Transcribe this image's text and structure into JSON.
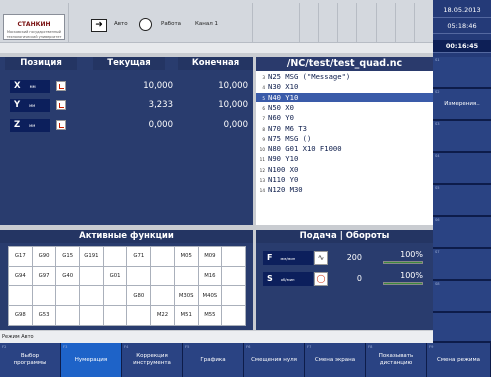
{
  "header": {
    "logo": {
      "title": "СТАНКИН",
      "subtitle": "Московский государственный технологический университет"
    },
    "mode_label": "Авто",
    "status_label": "Работа",
    "channel_label": "Канал 1",
    "date": "18.05.2013",
    "time": "05:18:46",
    "runtime": "00:16:45"
  },
  "position": {
    "col_axis": "Позиция",
    "col_current": "Текущая",
    "col_target": "Конечная",
    "axes": [
      {
        "name": "X",
        "unit": "мм",
        "current": "10,000",
        "target": "10,000"
      },
      {
        "name": "Y",
        "unit": "мм",
        "current": "3,233",
        "target": "10,000"
      },
      {
        "name": "Z",
        "unit": "мм",
        "current": "0,000",
        "target": "0,000"
      }
    ]
  },
  "program": {
    "title": "/NC/test/test_quad.nc",
    "lines": [
      {
        "n": "3",
        "text": "N25 MSG (\"Message\")",
        "active": false
      },
      {
        "n": "4",
        "text": "N30 X10",
        "active": false
      },
      {
        "n": "5",
        "text": "N40 Y10",
        "active": true
      },
      {
        "n": "6",
        "text": "N50 X0",
        "active": false
      },
      {
        "n": "7",
        "text": "N60 Y0",
        "active": false
      },
      {
        "n": "8",
        "text": "N70 M6 T3",
        "active": false
      },
      {
        "n": "9",
        "text": "N75 MSG ()",
        "active": false
      },
      {
        "n": "10",
        "text": "N80 G01 X10 F1000",
        "active": false
      },
      {
        "n": "11",
        "text": "N90 Y10",
        "active": false
      },
      {
        "n": "12",
        "text": "N100 X0",
        "active": false
      },
      {
        "n": "13",
        "text": "N110 Y0",
        "active": false
      },
      {
        "n": "14",
        "text": "N120 M30",
        "active": false
      }
    ]
  },
  "active_functions": {
    "title": "Активные функции",
    "rows": [
      [
        "G17",
        "G90",
        "G15",
        "G191",
        "",
        "G71",
        "",
        "M05",
        "M09",
        ""
      ],
      [
        "G94",
        "G97",
        "G40",
        "",
        "G01",
        "",
        "",
        "",
        "M16",
        ""
      ],
      [
        "",
        "",
        "",
        "",
        "",
        "G80",
        "",
        "M30S",
        "M40S",
        ""
      ],
      [
        "G98",
        "G53",
        "",
        "",
        "",
        "",
        "M22",
        "M51",
        "M55",
        ""
      ]
    ]
  },
  "feed": {
    "title": "Подача | Обороты",
    "feed_label": "F",
    "feed_unit": "мм/мин",
    "feed_value": "200",
    "feed_override": "100%",
    "feed_override_fraction": 1.0,
    "speed_label": "S",
    "speed_unit": "об/мин",
    "speed_value": "0",
    "speed_override": "100%",
    "speed_override_fraction": 1.0
  },
  "status_line": "Режим Авто",
  "right_softkeys": [
    {
      "num": "S1",
      "label": ""
    },
    {
      "num": "S2",
      "label": "Измерения.."
    },
    {
      "num": "S3",
      "label": ""
    },
    {
      "num": "S4",
      "label": ""
    },
    {
      "num": "S5",
      "label": ""
    },
    {
      "num": "S6",
      "label": ""
    },
    {
      "num": "S7",
      "label": ""
    },
    {
      "num": "S8",
      "label": ""
    }
  ],
  "bottom_softkeys": [
    {
      "num": "F2",
      "label": "Выбор программы",
      "selected": false
    },
    {
      "num": "F3",
      "label": "Нумерация",
      "selected": true
    },
    {
      "num": "F4",
      "label": "Коррекция инструмента",
      "selected": false
    },
    {
      "num": "F5",
      "label": "Графика",
      "selected": false
    },
    {
      "num": "F6",
      "label": "Смещения нуля",
      "selected": false
    },
    {
      "num": "F7",
      "label": "Смена экрана",
      "selected": false
    },
    {
      "num": "F8",
      "label": "Показывать дистанцию",
      "selected": false
    },
    {
      "num": "F9",
      "label": "Смена режима",
      "selected": false
    }
  ]
}
